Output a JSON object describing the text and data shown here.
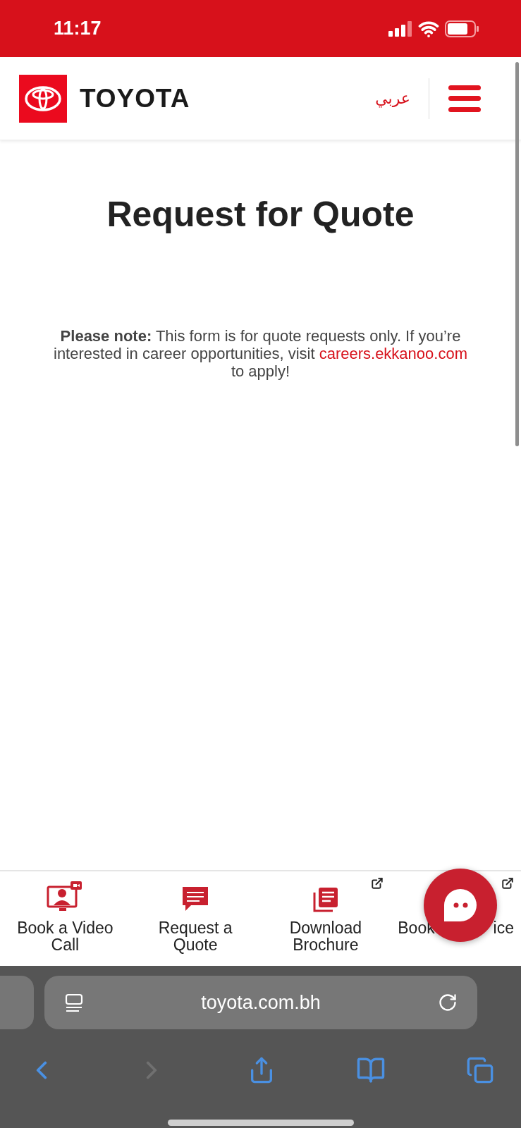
{
  "status_bar": {
    "time": "11:17"
  },
  "header": {
    "brand": "TOYOTA",
    "language_link": "عربي"
  },
  "page": {
    "title": "Request for Quote",
    "note": {
      "text": "**Please note:** This form is for quote requests only. If you’re interested in career opportunities, visit",
      "link": "careers.ekkanoo.com",
      "after": "to apply!"
    }
  },
  "quick_actions": [
    {
      "kind": "video_call",
      "lines": [
        "Book a Video",
        "Call"
      ],
      "external": false,
      "covered": false
    },
    {
      "kind": "quote",
      "lines": [
        "Request a",
        "Quote"
      ],
      "external": false,
      "covered": false
    },
    {
      "kind": "brochure",
      "lines": [
        "Download",
        "Brochure"
      ],
      "external": true,
      "covered": false
    },
    {
      "kind": "service",
      "lines": [
        "Book",
        "ice"
      ],
      "external": true,
      "covered": true
    }
  ],
  "browser": {
    "url": "toyota.com.bh",
    "forward_disabled": true
  }
}
